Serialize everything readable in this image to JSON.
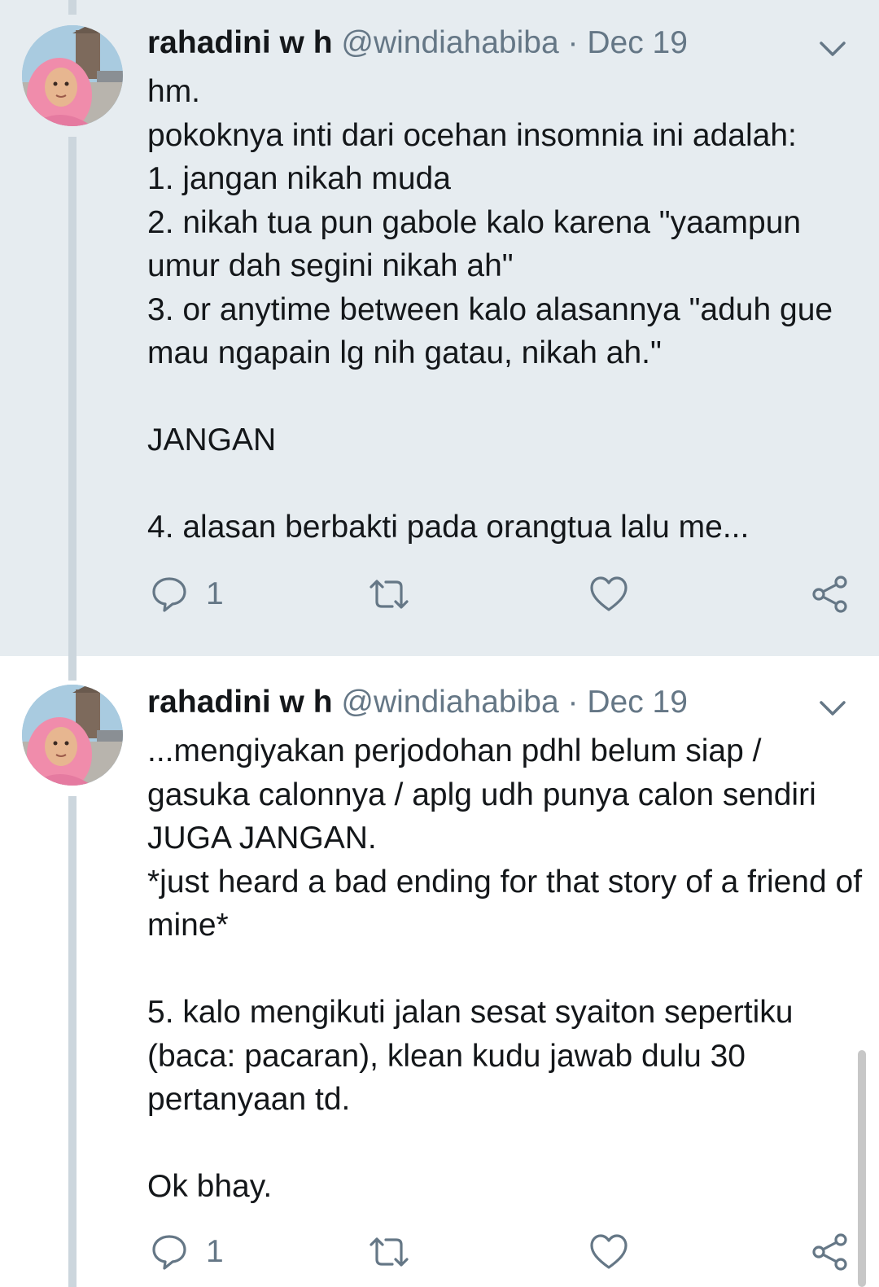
{
  "colors": {
    "thread_bg": "#e6ecf0",
    "thread_line": "#ccd6dd",
    "secondary_text": "#657786",
    "primary_text": "#14171a"
  },
  "tweets": [
    {
      "name": "rahadini w h",
      "handle": "@windiahabiba",
      "separator": "·",
      "date": "Dec 19",
      "text": "hm.\npokoknya inti dari ocehan insomnia ini adalah:\n1. jangan nikah muda\n2. nikah tua pun gabole kalo karena \"yaampun umur dah segini nikah ah\"\n3. or anytime between kalo alasannya \"aduh gue mau ngapain lg nih gatau, nikah ah.\"\n\nJANGAN\n\n4. alasan berbakti pada orangtua lalu me...",
      "reply_count": "1",
      "icons": {
        "reply": "reply-icon",
        "retweet": "retweet-icon",
        "like": "heart-icon",
        "share": "share-icon",
        "menu": "chevron-down-icon"
      }
    },
    {
      "name": "rahadini w h",
      "handle": "@windiahabiba",
      "separator": "·",
      "date": "Dec 19",
      "text": "...mengiyakan perjodohan pdhl belum siap / gasuka calonnya / aplg udh punya calon sendiri JUGA JANGAN.\n*just heard a bad ending for that story of a friend of mine*\n\n5. kalo mengikuti jalan sesat syaiton sepertiku (baca: pacaran), klean kudu jawab dulu 30 pertanyaan td.\n\nOk bhay.",
      "reply_count": "1",
      "icons": {
        "reply": "reply-icon",
        "retweet": "retweet-icon",
        "like": "heart-icon",
        "share": "share-icon",
        "menu": "chevron-down-icon"
      }
    }
  ]
}
